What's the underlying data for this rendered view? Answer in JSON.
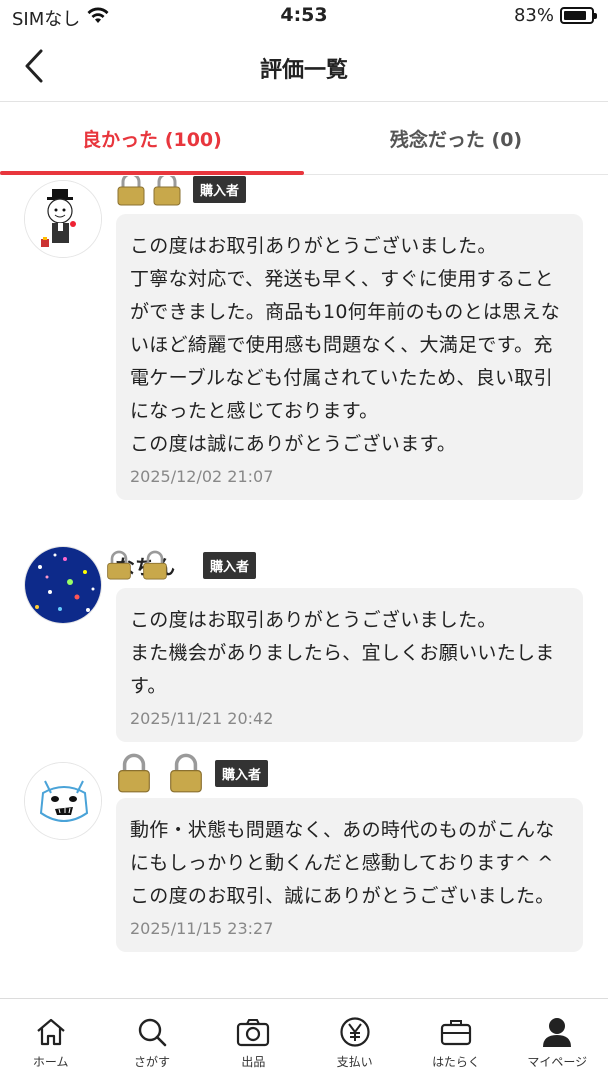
{
  "status_bar": {
    "carrier": "SIMなし",
    "time": "4:53",
    "battery_pct": "83%",
    "battery_level": 0.83
  },
  "header": {
    "title": "評価一覧"
  },
  "tabs": [
    {
      "label": "良かった (100)",
      "active": true
    },
    {
      "label": "残念だった (0)",
      "active": false
    }
  ],
  "reviews": [
    {
      "nickname": "",
      "badge": "購入者",
      "comment": "この度はお取引ありがとうございました。\n丁寧な対応で、発送も早く、すぐに使用することができました。商品も10何年前のものとは思えないほど綺麗で使用感も問題なく、大満足です。充電ケーブルなども付属されていたため、良い取引になったと感じております。\nこの度は誠にありがとうございます。",
      "date": "2025/12/02 21:07"
    },
    {
      "nickname": "なちん",
      "badge": "購入者",
      "comment": "この度はお取引ありがとうございました。\nまた機会がありましたら、宜しくお願いいたします。",
      "date": "2025/11/21 20:42"
    },
    {
      "nickname": "",
      "badge": "購入者",
      "comment": "動作・状態も問題なく、あの時代のものがこんなにもしっかりと動くんだと感動しております^ ^\nこの度のお取引、誠にありがとうございました。",
      "date": "2025/11/15 23:27"
    }
  ],
  "bottom_nav": [
    {
      "label": "ホーム",
      "icon": "home-icon"
    },
    {
      "label": "さがす",
      "icon": "search-icon"
    },
    {
      "label": "出品",
      "icon": "camera-icon"
    },
    {
      "label": "支払い",
      "icon": "yen-icon"
    },
    {
      "label": "はたらく",
      "icon": "briefcase-icon"
    },
    {
      "label": "マイページ",
      "icon": "person-icon"
    }
  ],
  "colors": {
    "accent": "#e8363d",
    "bubble": "#f2f2f2",
    "badge": "#333333",
    "date": "#888888"
  }
}
